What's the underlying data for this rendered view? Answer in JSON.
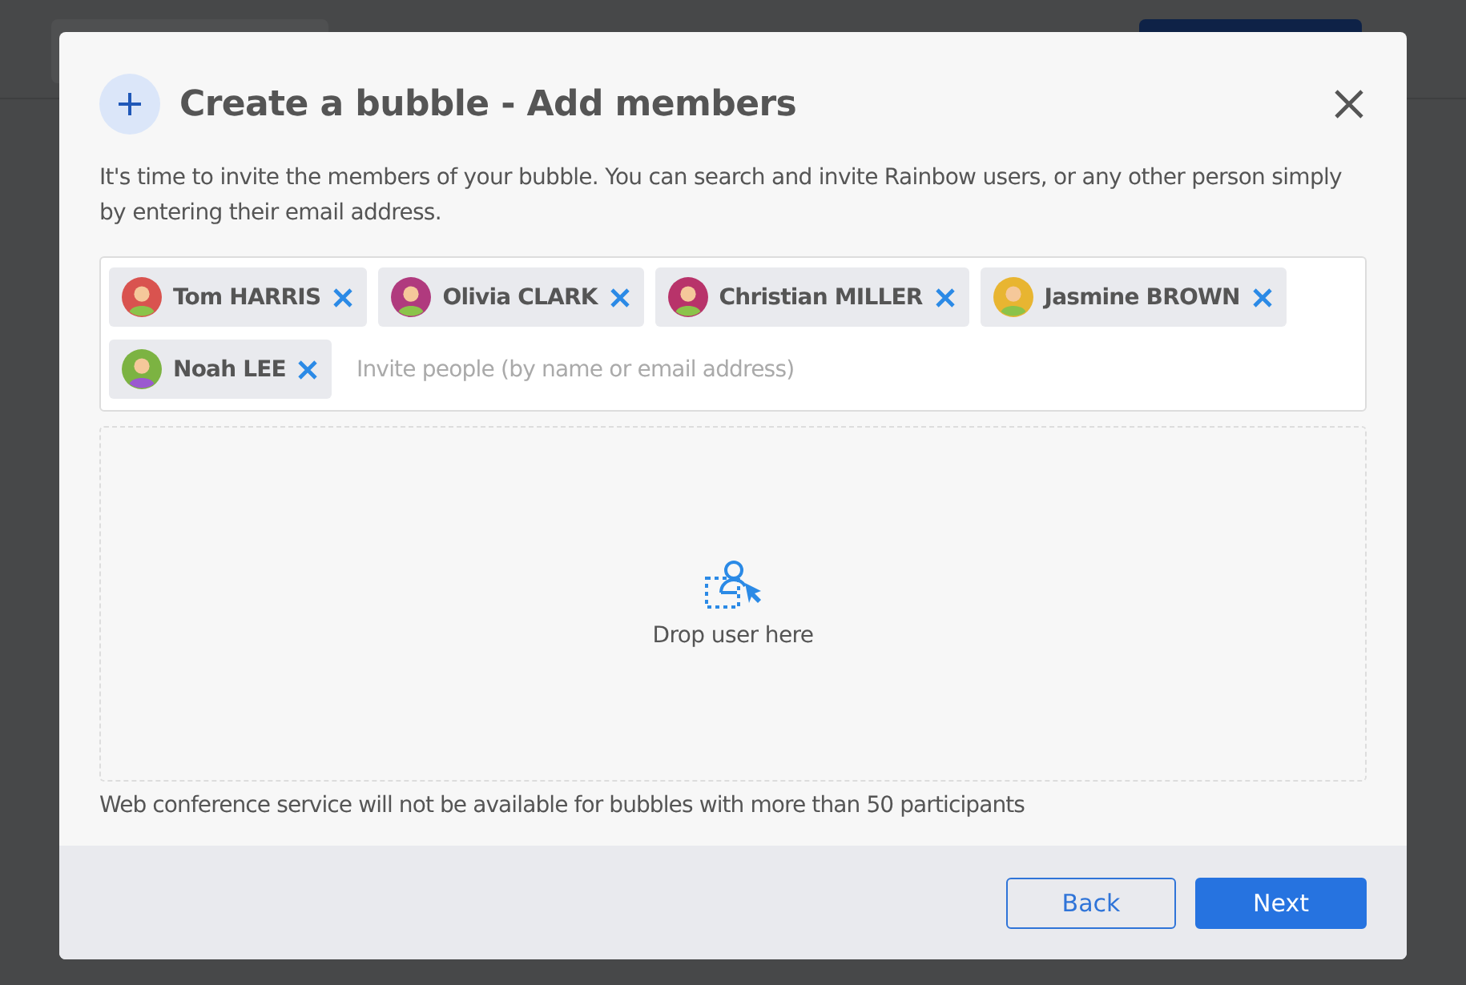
{
  "dialog": {
    "title": "Create a bubble - Add members",
    "intro": "It's time to invite the members of your bubble. You can search and invite Rainbow users, or any other person simply by entering their email address.",
    "members": [
      {
        "name": "Tom HARRIS",
        "color": "#d9534f"
      },
      {
        "name": "Olivia CLARK",
        "color": "#b03a7e"
      },
      {
        "name": "Christian MILLER",
        "color": "#b8336a"
      },
      {
        "name": "Jasmine BROWN",
        "color": "#e8b531"
      },
      {
        "name": "Noah LEE",
        "color": "#7cb342"
      }
    ],
    "invite_field": {
      "placeholder": "Invite people (by name or email address)"
    },
    "drop_zone": {
      "label": "Drop user here"
    },
    "notice": "Web conference service will not be available for bubbles with more than 50 participants",
    "buttons": [
      {
        "label": "Back",
        "kind": "secondary"
      },
      {
        "label": "Next",
        "kind": "primary"
      }
    ]
  }
}
